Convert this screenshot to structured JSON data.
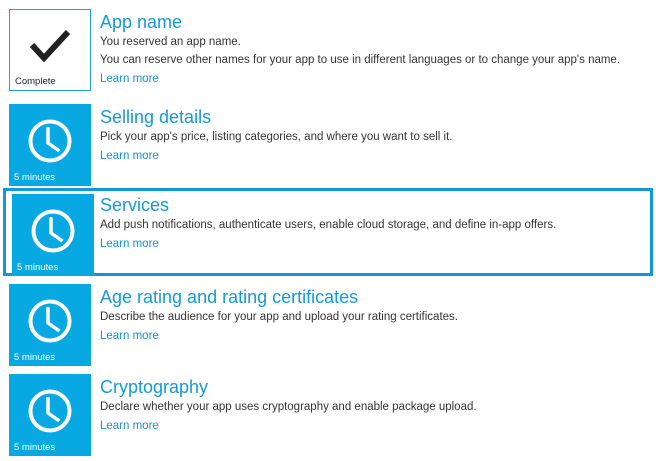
{
  "colors": {
    "tile": "#08a8e3",
    "accent": "#149ad6",
    "highlight_border": "#1496da"
  },
  "steps": [
    {
      "title": "App name",
      "status": "Complete",
      "icon": "checkmark-icon",
      "lines": [
        "You reserved an app name.",
        "You can reserve other names for your app to use in different languages or to change your app's name."
      ],
      "link": "Learn more"
    },
    {
      "title": "Selling details",
      "status": "5 minutes",
      "icon": "clock-icon",
      "lines": [
        "Pick your app's price, listing categories, and where you want to sell it."
      ],
      "link": "Learn more"
    },
    {
      "title": "Services",
      "status": "5 minutes",
      "icon": "clock-icon",
      "selected": true,
      "lines": [
        "Add push notifications, authenticate users, enable cloud storage, and define in-app offers."
      ],
      "link": "Learn more"
    },
    {
      "title": "Age rating and rating certificates",
      "status": "5 minutes",
      "icon": "clock-icon",
      "lines": [
        "Describe the audience for your app and upload your rating certificates."
      ],
      "link": "Learn more"
    },
    {
      "title": "Cryptography",
      "status": "5 minutes",
      "icon": "clock-icon",
      "lines": [
        "Declare whether your app uses cryptography and enable package upload."
      ],
      "link": "Learn more"
    }
  ]
}
